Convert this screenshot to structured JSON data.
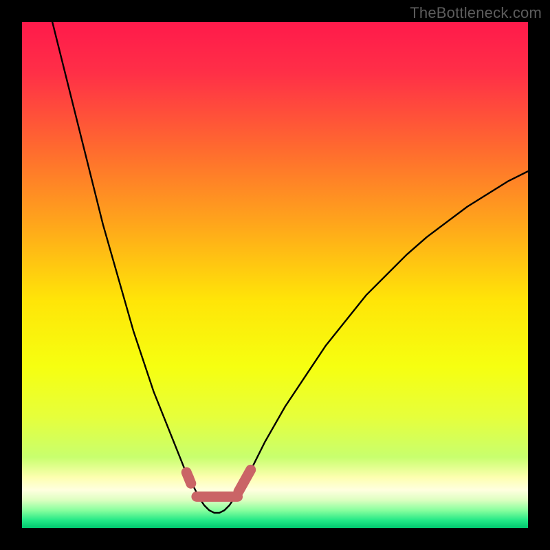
{
  "watermark": {
    "text": "TheBottleneck.com"
  },
  "colors": {
    "frame": "#000000",
    "curve": "#000000",
    "highlight": "#ca6466",
    "gradient_stops": [
      {
        "offset": 0.0,
        "color": "#ff1a4b"
      },
      {
        "offset": 0.1,
        "color": "#ff2f47"
      },
      {
        "offset": 0.25,
        "color": "#ff6a2f"
      },
      {
        "offset": 0.4,
        "color": "#ffa61b"
      },
      {
        "offset": 0.55,
        "color": "#ffe508"
      },
      {
        "offset": 0.68,
        "color": "#f6ff10"
      },
      {
        "offset": 0.78,
        "color": "#e6ff3b"
      },
      {
        "offset": 0.86,
        "color": "#c8ff6e"
      },
      {
        "offset": 0.9,
        "color": "#fdffb0"
      },
      {
        "offset": 0.925,
        "color": "#ffffe0"
      },
      {
        "offset": 0.945,
        "color": "#dcffc0"
      },
      {
        "offset": 0.965,
        "color": "#88ff9e"
      },
      {
        "offset": 0.985,
        "color": "#22e886"
      },
      {
        "offset": 1.0,
        "color": "#00c86f"
      }
    ]
  },
  "chart_data": {
    "type": "line",
    "title": "",
    "xlabel": "",
    "ylabel": "",
    "xlim": [
      0,
      100
    ],
    "ylim": [
      0,
      100
    ],
    "series": [
      {
        "name": "bottleneck-curve",
        "x": [
          6,
          8,
          10,
          12,
          14,
          16,
          18,
          20,
          22,
          24,
          26,
          28,
          30,
          32,
          33,
          34,
          35,
          36,
          37,
          38,
          39,
          40,
          41,
          42,
          44,
          46,
          48,
          52,
          56,
          60,
          64,
          68,
          72,
          76,
          80,
          84,
          88,
          92,
          96,
          100
        ],
        "y": [
          100,
          92,
          84,
          76,
          68,
          60,
          53,
          46,
          39,
          33,
          27,
          22,
          17,
          12,
          10,
          8,
          6,
          4.5,
          3.5,
          3,
          3,
          3.5,
          4.5,
          6,
          9,
          13,
          17,
          24,
          30,
          36,
          41,
          46,
          50,
          54,
          57.5,
          60.5,
          63.5,
          66,
          68.5,
          70.5
        ]
      }
    ],
    "highlights": {
      "name": "curve-bottom-highlight",
      "segments": [
        {
          "x0": 32.5,
          "y0": 11.0,
          "x1": 33.4,
          "y1": 8.8
        },
        {
          "x0": 34.5,
          "y0": 6.2,
          "x1": 42.6,
          "y1": 6.2
        },
        {
          "x0": 42.8,
          "y0": 7.2,
          "x1": 45.2,
          "y1": 11.5
        }
      ],
      "dot": {
        "x": 33.0,
        "y": 10.0
      }
    }
  }
}
